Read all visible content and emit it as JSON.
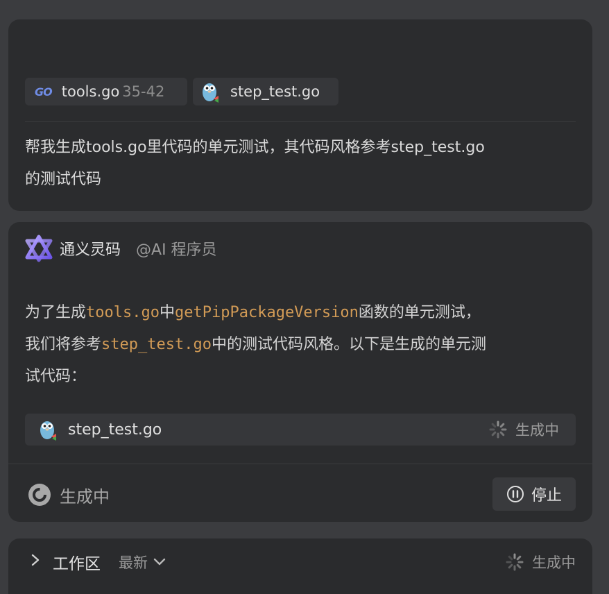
{
  "user_message": {
    "files": [
      {
        "logo": "GO",
        "name": "tools.go",
        "range": "35-42",
        "icon": "go-logo-icon"
      },
      {
        "name": "step_test.go",
        "icon": "gopher-icon"
      }
    ],
    "text_line1": "帮我生成tools.go里代码的单元测试，其代码风格参考step_test.go",
    "text_line2": "的测试代码"
  },
  "assistant": {
    "name": "通义灵码",
    "role": "@AI 程序员",
    "message": {
      "p1": "为了生成",
      "c1": "tools.go",
      "p2": "中",
      "c2": "getPipPackageVersion",
      "p3": "函数的单元测试，",
      "p4": "我们将参考",
      "c3": "step_test.go",
      "p5": "中的测试代码风格。以下是生成的单元测",
      "p6": "试代码："
    },
    "generating_file": {
      "name": "step_test.go",
      "status": "生成中",
      "icon": "gopher-icon"
    },
    "footer": {
      "status": "生成中",
      "stop_label": "停止"
    }
  },
  "workspace": {
    "title": "工作区",
    "filter": "最新",
    "status": "生成中"
  },
  "colors": {
    "background": "#3b3c3f",
    "card": "#2b2c2e",
    "code_accent": "#d29b56",
    "go_blue": "#6f8ce6"
  }
}
